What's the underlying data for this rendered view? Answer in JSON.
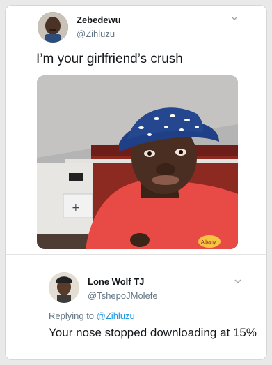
{
  "tweet": {
    "author": {
      "name": "Zebedewu",
      "handle": "@Zihluzu"
    },
    "text": "I’m your girlfriend’s crush",
    "media": {
      "sign_text": "Albany"
    }
  },
  "reply": {
    "author": {
      "name": "Lone Wolf TJ",
      "handle": "@TshepoJMolefe"
    },
    "replying_to_prefix": "Replying to",
    "replying_to_handle": "@Zihluzu",
    "text": "Your nose stopped downloading at 15%"
  },
  "colors": {
    "link": "#1b95e0",
    "secondary_text": "#657786",
    "primary_text": "#14171a",
    "shirt": "#e84a46",
    "hat": "#1f3f86"
  },
  "icons": [
    "chevron-down-icon",
    "chevron-down-icon"
  ]
}
